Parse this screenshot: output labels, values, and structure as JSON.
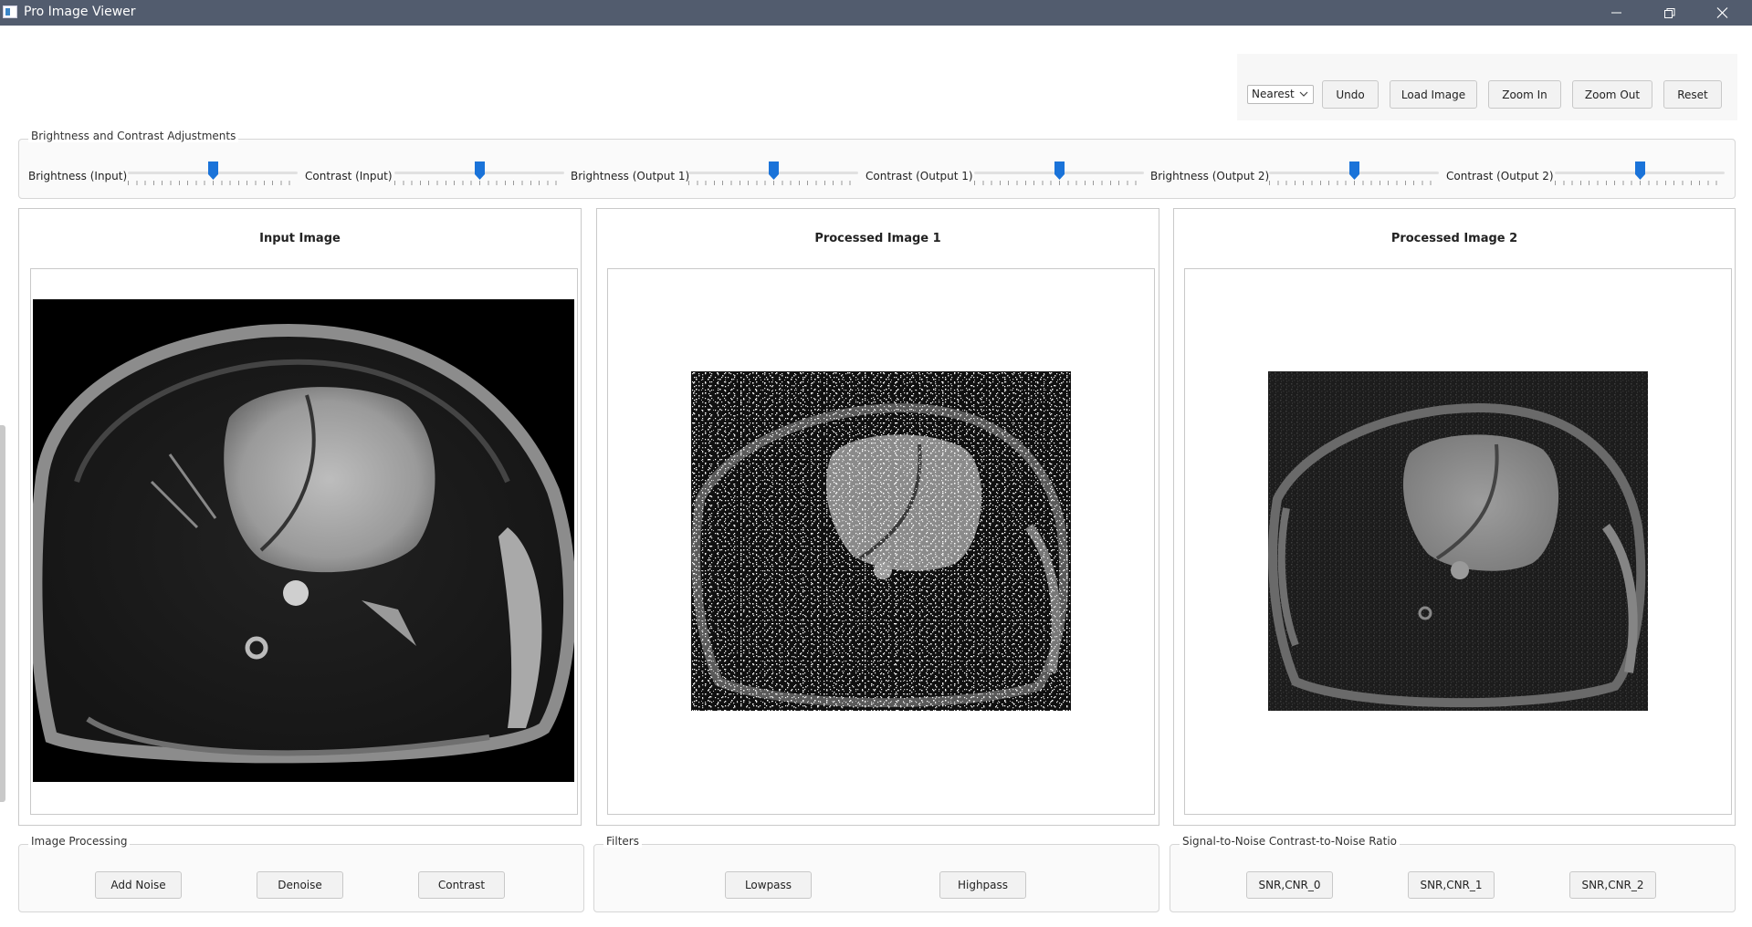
{
  "window": {
    "title": "Pro Image Viewer"
  },
  "toolbar": {
    "interpolation": {
      "selected": "Nearest"
    },
    "undo": "Undo",
    "load_image": "Load Image",
    "zoom_in": "Zoom In",
    "zoom_out": "Zoom Out",
    "reset": "Reset"
  },
  "adjustments": {
    "title": "Brightness and Contrast Adjustments",
    "sliders": [
      {
        "label": "Brightness (Input)",
        "value": 0.5
      },
      {
        "label": "Contrast (Input)",
        "value": 0.5
      },
      {
        "label": "Brightness (Output 1)",
        "value": 0.5
      },
      {
        "label": "Contrast (Output 1)",
        "value": 0.5
      },
      {
        "label": "Brightness (Output 2)",
        "value": 0.5
      },
      {
        "label": "Contrast (Output 2)",
        "value": 0.5
      }
    ]
  },
  "panels": {
    "input": {
      "title": "Input Image"
    },
    "processed1": {
      "title": "Processed Image 1"
    },
    "processed2": {
      "title": "Processed Image 2"
    }
  },
  "image_processing": {
    "title": "Image Processing",
    "add_noise": "Add Noise",
    "denoise": "Denoise",
    "contrast": "Contrast"
  },
  "filters": {
    "title": "Filters",
    "lowpass": "Lowpass",
    "highpass": "Highpass"
  },
  "snr": {
    "title": "Signal-to-Noise  Contrast-to-Noise Ratio",
    "btn0": "SNR,CNR_0",
    "btn1": "SNR,CNR_1",
    "btn2": "SNR,CNR_2"
  },
  "colors": {
    "titlebar": "#525c6e",
    "slider_thumb": "#1a73d9"
  }
}
